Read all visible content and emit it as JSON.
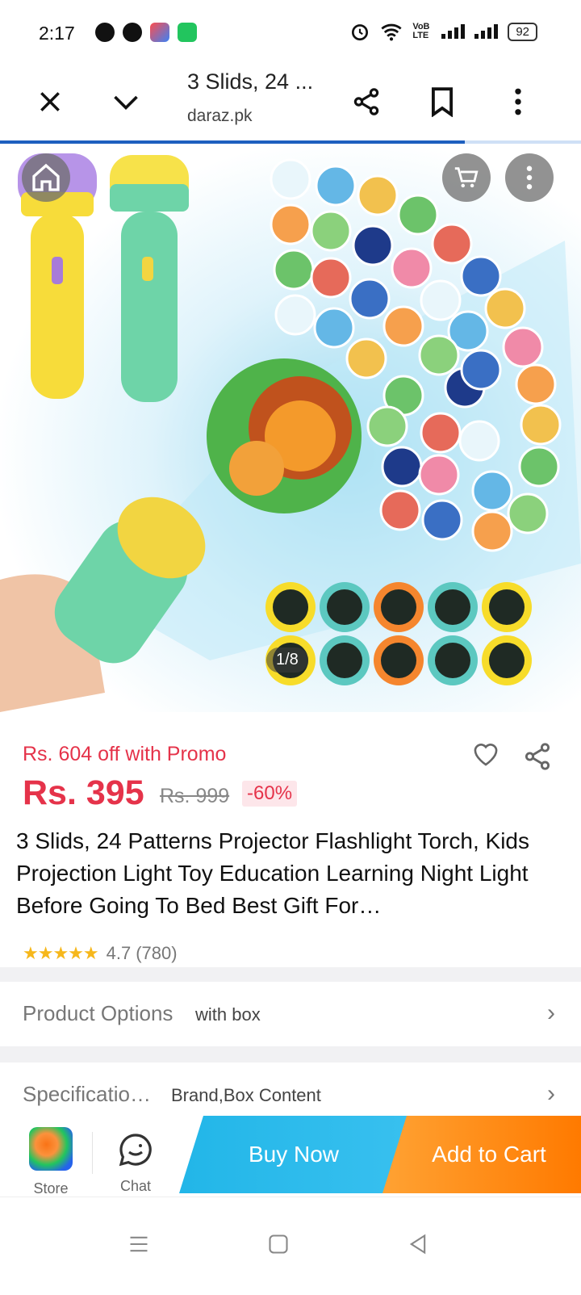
{
  "status_bar": {
    "time": "2:17",
    "network_label": "VoB LTE",
    "battery": "92"
  },
  "browser": {
    "page_title": "3 Slids, 24 ...",
    "url": "daraz.pk",
    "load_progress_percent": 80
  },
  "gallery": {
    "counter": "1/8"
  },
  "product": {
    "promo_text": "Rs. 604 off with Promo",
    "price": "Rs. 395",
    "original_price": "Rs. 999",
    "discount": "-60%",
    "title": "3 Slids, 24 Patterns Projector Flashlight Torch, Kids Projection Light Toy Education Learning Night Light Before Going To Bed Best Gift For…",
    "rating_value": "4.7",
    "rating_count": "(780)",
    "stars": "★★★★★"
  },
  "rows": [
    {
      "label": "Product Options",
      "value": "with box"
    },
    {
      "label": "Specificatio…",
      "value": "Brand,Box Content"
    }
  ],
  "actions": {
    "store_label": "Store",
    "chat_label": "Chat",
    "buy_now": "Buy Now",
    "add_to_cart": "Add to Cart"
  },
  "colors": {
    "price_red": "#e5334a",
    "buy_blue": "#22b6e8",
    "cart_orange": "#ff7a00",
    "progress_blue": "#1d5fbf"
  },
  "icons": [
    "close-icon",
    "chevron-down-icon",
    "share-icon",
    "bookmark-icon",
    "more-vert-icon",
    "home-icon",
    "cart-icon",
    "heart-icon",
    "chat-icon",
    "chevron-right-icon",
    "menu-nav-icon",
    "home-nav-icon",
    "back-nav-icon"
  ]
}
